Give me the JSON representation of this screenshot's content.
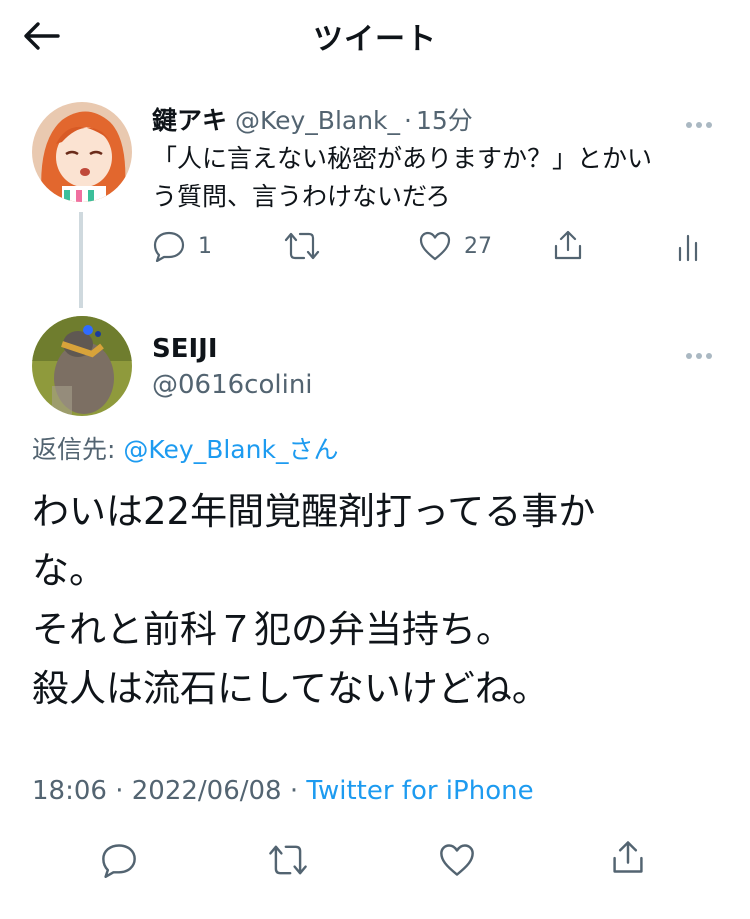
{
  "header": {
    "title": "ツイート"
  },
  "parent_tweet": {
    "display_name": "鍵アキ",
    "handle": "@Key_Blank_",
    "separator": "·",
    "time_ago": "15分",
    "text_line1": "「人に言えない秘密がありますか？」とかい",
    "text_line2": "う質問、言うわけないだろ",
    "reply_count": "1",
    "like_count": "27",
    "icons": [
      "reply-icon",
      "retweet-icon",
      "like-icon",
      "share-icon",
      "analytics-icon"
    ]
  },
  "main_tweet": {
    "display_name": "SEIJI",
    "handle": "@0616colini",
    "reply_to_label": "返信先:",
    "reply_to_handle": "@Key_Blank_さん",
    "text_line1": "わいは22年間覚醒剤打ってる事か",
    "text_line2": "な。",
    "text_line3": "それと前科７犯の弁当持ち。",
    "text_line4": "殺人は流石にしてないけどね。",
    "time": "18:06",
    "dot": "·",
    "date": "2022/06/08",
    "dot2": "·",
    "source": "Twitter for iPhone",
    "icons": [
      "reply-icon",
      "retweet-icon",
      "like-icon",
      "share-icon"
    ]
  },
  "colors": {
    "link": "#1d9bf0",
    "muted": "#536471",
    "thread_line": "#cfd9de"
  }
}
